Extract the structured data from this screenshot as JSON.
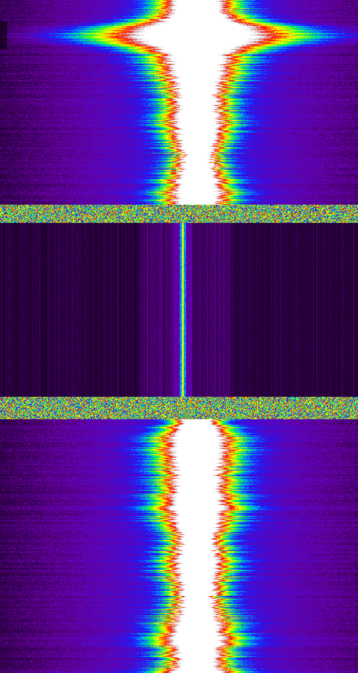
{
  "display": {
    "type": "spectrogram-waterfall",
    "palette": [
      "#000000",
      "#2a0040",
      "#6a00a8",
      "#1a1aff",
      "#00a0ff",
      "#00ff40",
      "#c8ff00",
      "#ffff00",
      "#ff8000",
      "#ff0000",
      "#d0d0d0",
      "#ffffff"
    ],
    "segments": [
      {
        "name": "upper-signal",
        "state": "active",
        "burst_at_top": true
      },
      {
        "name": "noise-band-1",
        "state": "transition"
      },
      {
        "name": "dropout",
        "state": "no-signal",
        "has_residual_carrier": true
      },
      {
        "name": "noise-band-2",
        "state": "transition"
      },
      {
        "name": "lower-signal",
        "state": "active"
      }
    ]
  }
}
